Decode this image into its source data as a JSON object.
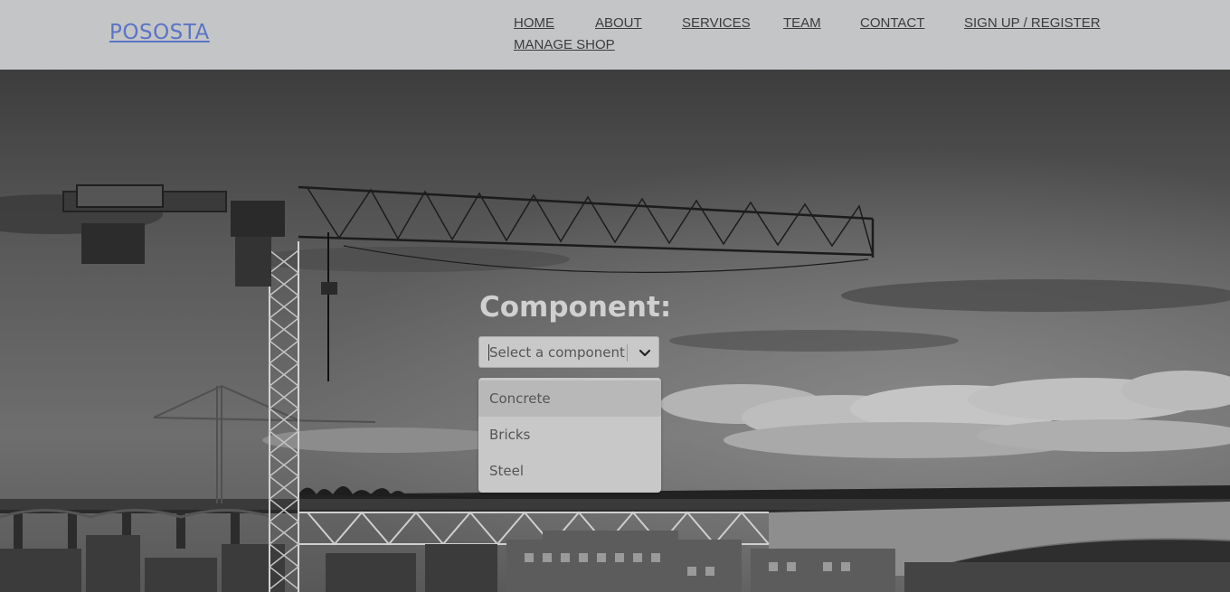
{
  "brand": {
    "logo": "POSOSTA",
    "link_color": "#5b74c4"
  },
  "nav": {
    "home": "HOME",
    "about": "ABOUT",
    "services": "SERVICES",
    "team": "TEAM",
    "contact": "CONTACT",
    "signup": "SIGN UP / REGISTER",
    "manage_shop": "MANAGE SHOP"
  },
  "form": {
    "title": "Component:",
    "select": {
      "placeholder": "Select a component",
      "icon": "chevron-down-icon"
    },
    "options": [
      {
        "label": "Concrete",
        "highlighted": true
      },
      {
        "label": "Bricks",
        "highlighted": false
      },
      {
        "label": "Steel",
        "highlighted": false
      }
    ]
  },
  "colors": {
    "header_bg": "#c4c5c7",
    "nav_text": "#3c3c3c"
  }
}
